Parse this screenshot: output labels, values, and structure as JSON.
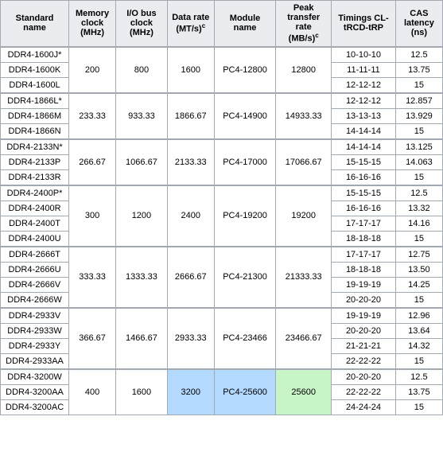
{
  "table": {
    "headers": [
      {
        "label": "Standard name",
        "col": "standard"
      },
      {
        "label": "Memory clock (MHz)",
        "col": "memory"
      },
      {
        "label": "I/O bus clock (MHz)",
        "col": "io"
      },
      {
        "label": "Data rate (MT/s)",
        "col": "data",
        "sup": "c"
      },
      {
        "label": "Module name",
        "col": "module"
      },
      {
        "label": "Peak transfer rate (MB/s)",
        "col": "peak",
        "sup": "c"
      },
      {
        "label": "Timings CL-tRCD-tRP",
        "col": "timings"
      },
      {
        "label": "CAS latency (ns)",
        "col": "cas"
      }
    ],
    "groups": [
      {
        "memory_clock": "200",
        "io_clock": "800",
        "data_rate": "1600",
        "module": "PC4-12800",
        "peak": "12800",
        "rows": [
          {
            "standard": "DDR4-1600J*",
            "timings": "10-10-10",
            "cas": "12.5"
          },
          {
            "standard": "DDR4-1600K",
            "timings": "11-11-11",
            "cas": "13.75"
          },
          {
            "standard": "DDR4-1600L",
            "timings": "12-12-12",
            "cas": "15"
          }
        ]
      },
      {
        "memory_clock": "233.33",
        "io_clock": "933.33",
        "data_rate": "1866.67",
        "module": "PC4-14900",
        "peak": "14933.33",
        "rows": [
          {
            "standard": "DDR4-1866L*",
            "timings": "12-12-12",
            "cas": "12.857"
          },
          {
            "standard": "DDR4-1866M",
            "timings": "13-13-13",
            "cas": "13.929"
          },
          {
            "standard": "DDR4-1866N",
            "timings": "14-14-14",
            "cas": "15"
          }
        ]
      },
      {
        "memory_clock": "266.67",
        "io_clock": "1066.67",
        "data_rate": "2133.33",
        "module": "PC4-17000",
        "peak": "17066.67",
        "rows": [
          {
            "standard": "DDR4-2133N*",
            "timings": "14-14-14",
            "cas": "13.125"
          },
          {
            "standard": "DDR4-2133P",
            "timings": "15-15-15",
            "cas": "14.063"
          },
          {
            "standard": "DDR4-2133R",
            "timings": "16-16-16",
            "cas": "15"
          }
        ]
      },
      {
        "memory_clock": "300",
        "io_clock": "1200",
        "data_rate": "2400",
        "module": "PC4-19200",
        "peak": "19200",
        "rows": [
          {
            "standard": "DDR4-2400P*",
            "timings": "15-15-15",
            "cas": "12.5"
          },
          {
            "standard": "DDR4-2400R",
            "timings": "16-16-16",
            "cas": "13.32"
          },
          {
            "standard": "DDR4-2400T",
            "timings": "17-17-17",
            "cas": "14.16"
          },
          {
            "standard": "DDR4-2400U",
            "timings": "18-18-18",
            "cas": "15"
          }
        ]
      },
      {
        "memory_clock": "333.33",
        "io_clock": "1333.33",
        "data_rate": "2666.67",
        "module": "PC4-21300",
        "peak": "21333.33",
        "rows": [
          {
            "standard": "DDR4-2666T",
            "timings": "17-17-17",
            "cas": "12.75"
          },
          {
            "standard": "DDR4-2666U",
            "timings": "18-18-18",
            "cas": "13.50"
          },
          {
            "standard": "DDR4-2666V",
            "timings": "19-19-19",
            "cas": "14.25"
          },
          {
            "standard": "DDR4-2666W",
            "timings": "20-20-20",
            "cas": "15"
          }
        ]
      },
      {
        "memory_clock": "366.67",
        "io_clock": "1466.67",
        "data_rate": "2933.33",
        "module": "PC4-23466",
        "peak": "23466.67",
        "rows": [
          {
            "standard": "DDR4-2933V",
            "timings": "19-19-19",
            "cas": "12.96"
          },
          {
            "standard": "DDR4-2933W",
            "timings": "20-20-20",
            "cas": "13.64"
          },
          {
            "standard": "DDR4-2933Y",
            "timings": "21-21-21",
            "cas": "14.32"
          },
          {
            "standard": "DDR4-2933AA",
            "timings": "22-22-22",
            "cas": "15"
          }
        ]
      },
      {
        "memory_clock": "400",
        "io_clock": "1600",
        "data_rate": "3200",
        "module": "PC4-25600",
        "peak": "25600",
        "data_highlight": true,
        "module_highlight": true,
        "peak_highlight": true,
        "rows": [
          {
            "standard": "DDR4-3200W",
            "timings": "20-20-20",
            "cas": "12.5"
          },
          {
            "standard": "DDR4-3200AA",
            "timings": "22-22-22",
            "cas": "13.75"
          },
          {
            "standard": "DDR4-3200AC",
            "timings": "24-24-24",
            "cas": "15"
          }
        ]
      }
    ]
  }
}
